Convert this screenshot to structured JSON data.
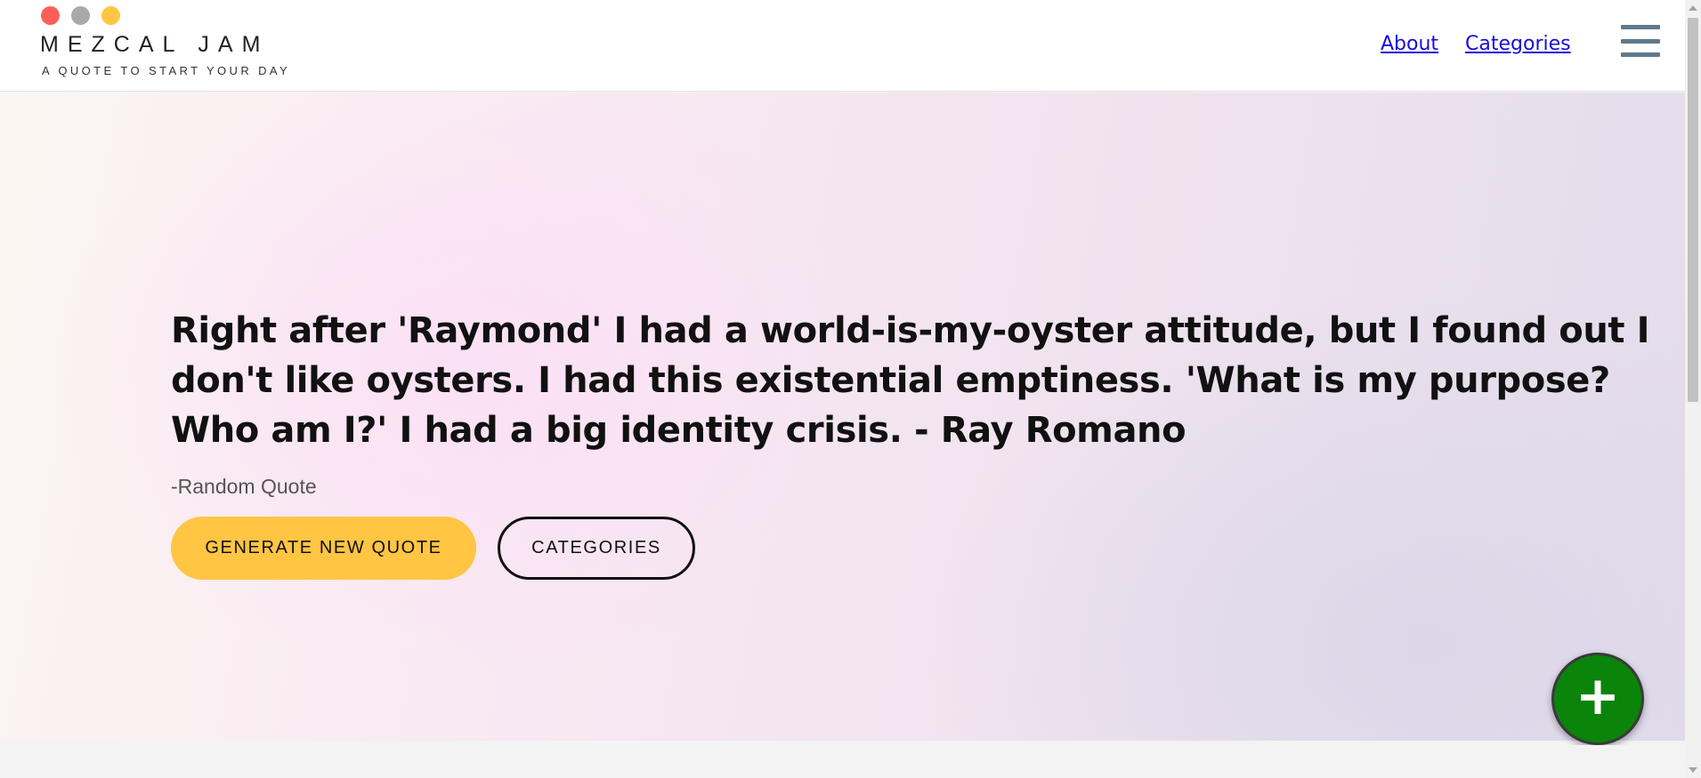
{
  "window_controls": {
    "close_color": "#ff5f57",
    "minimize_color": "#a9a9a9",
    "maximize_color": "#ffc543"
  },
  "brand": {
    "title": "MEZCAL JAM",
    "tagline": "A QUOTE TO START YOUR DAY"
  },
  "nav": {
    "about_label": "About",
    "categories_label": "Categories",
    "menu_icon": "hamburger-menu-icon"
  },
  "hero": {
    "quote": "Right after 'Raymond' I had a world-is-my-oyster attitude, but I found out I don't like oysters. I had this existential emptiness. 'What is my purpose? Who am I?' I had a big identity crisis. - Ray Romano",
    "source": "-Random Quote",
    "generate_button_label": "GENERATE NEW QUOTE",
    "categories_button_label": "CATEGORIES",
    "add_button_glyph": "+"
  },
  "colors": {
    "accent": "#ffc543",
    "link": "#1a0dd6",
    "fab": "#0a840a",
    "menu_icon": "#607a8c"
  }
}
